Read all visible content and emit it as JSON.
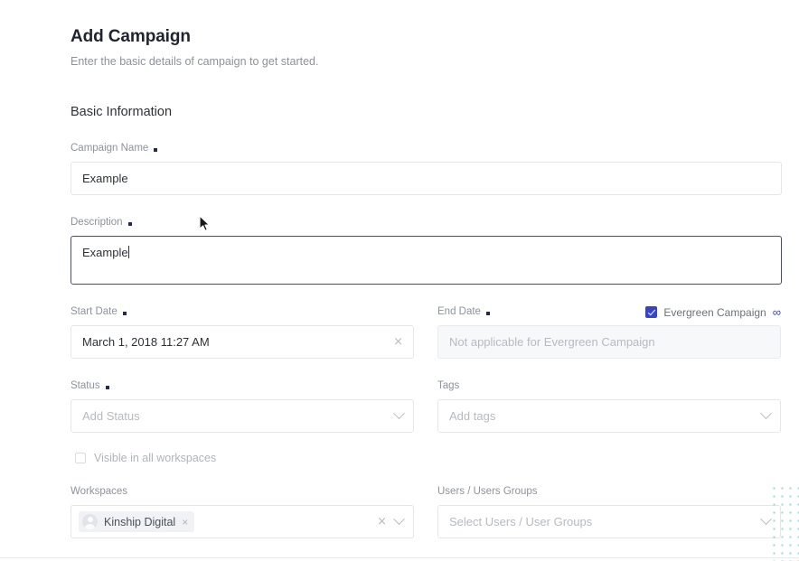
{
  "header": {
    "title": "Add Campaign",
    "subtitle": "Enter the basic details of campaign to get started."
  },
  "section": {
    "title": "Basic Information"
  },
  "fields": {
    "campaign_name": {
      "label": "Campaign Name",
      "required": true,
      "value": "Example"
    },
    "description": {
      "label": "Description",
      "required": true,
      "value": "Example",
      "focused": true
    },
    "start_date": {
      "label": "Start Date",
      "required": true,
      "value": "March 1, 2018 11:27 AM",
      "clear_icon": "close-icon"
    },
    "end_date": {
      "label": "End Date",
      "required": true,
      "value": "",
      "placeholder": "Not applicable for Evergreen Campaign",
      "disabled": true
    },
    "status": {
      "label": "Status",
      "required": true,
      "value": "",
      "placeholder": "Add Status",
      "dropdown_icon": "chevron-down-icon"
    },
    "tags": {
      "label": "Tags",
      "required": false,
      "value": "",
      "placeholder": "Add tags",
      "dropdown_icon": "chevron-down-icon"
    },
    "workspaces": {
      "label": "Workspaces",
      "required": false,
      "chips": [
        {
          "label": "Kinship Digital",
          "avatar": "user-avatar-icon",
          "remove_icon": "close-icon"
        }
      ],
      "clear_icon": "close-icon",
      "dropdown_icon": "chevron-down-icon"
    },
    "users_groups": {
      "label": "Users / Users Groups",
      "required": false,
      "value": "",
      "placeholder": "Select Users / User Groups",
      "dropdown_icon": "chevron-down-icon"
    }
  },
  "evergreen": {
    "label": "Evergreen Campaign",
    "checked": true,
    "symbol": "∞"
  },
  "visible_all_workspaces": {
    "label": "Visible in all workspaces",
    "checked": false
  },
  "icons": {
    "close": "×"
  },
  "colors": {
    "accent": "#3744c6",
    "required_dot": "#232a56",
    "text": "#2e3138",
    "muted": "#8d929c",
    "placeholder": "#b6bac2",
    "border": "#e4e6ea",
    "disabled_bg": "#f7f8fa",
    "chip_bg": "#f1f2f5",
    "decoration": "#7fd8cd"
  }
}
